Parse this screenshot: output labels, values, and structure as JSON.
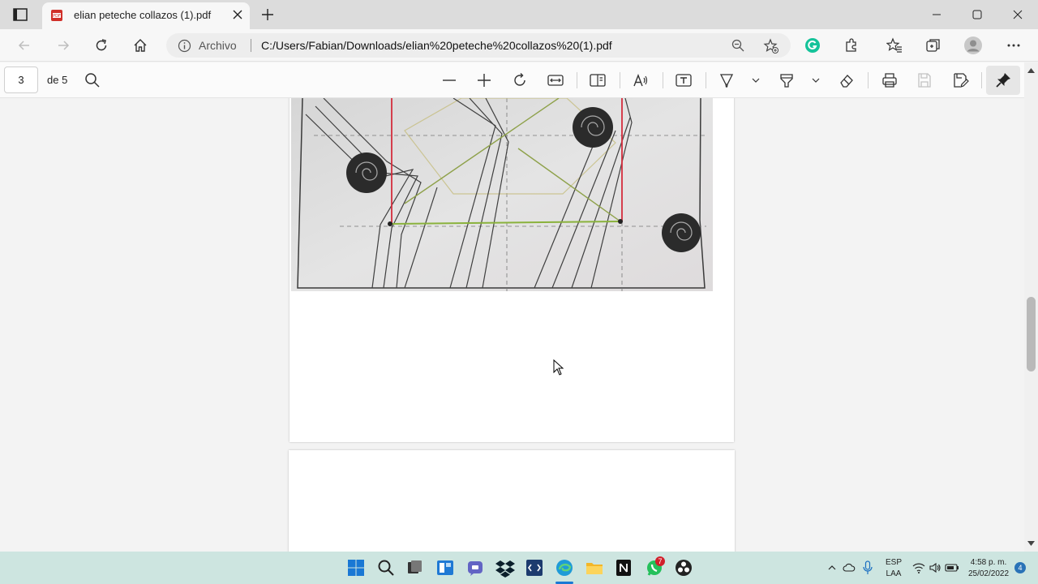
{
  "browser": {
    "tab_title": "elian peteche collazos (1).pdf",
    "address": {
      "scheme_label": "Archivo",
      "url": "C:/Users/Fabian/Downloads/elian%20peteche%20collazos%20(1).pdf"
    }
  },
  "pdf_toolbar": {
    "page_number": "3",
    "page_count_label": "de 5"
  },
  "taskbar": {
    "whatsapp_badge": "7",
    "language": "ESP",
    "layout": "LAA",
    "time": "4:58 p. m.",
    "date": "25/02/2022",
    "notification_count": "4"
  },
  "colors": {
    "accent_blue": "#0a64c8",
    "pdf_red": "#d0302a",
    "taskbar_bg": "#cde5e0",
    "drawing_red": "#d42d3d",
    "drawing_green": "#8ab23c"
  }
}
